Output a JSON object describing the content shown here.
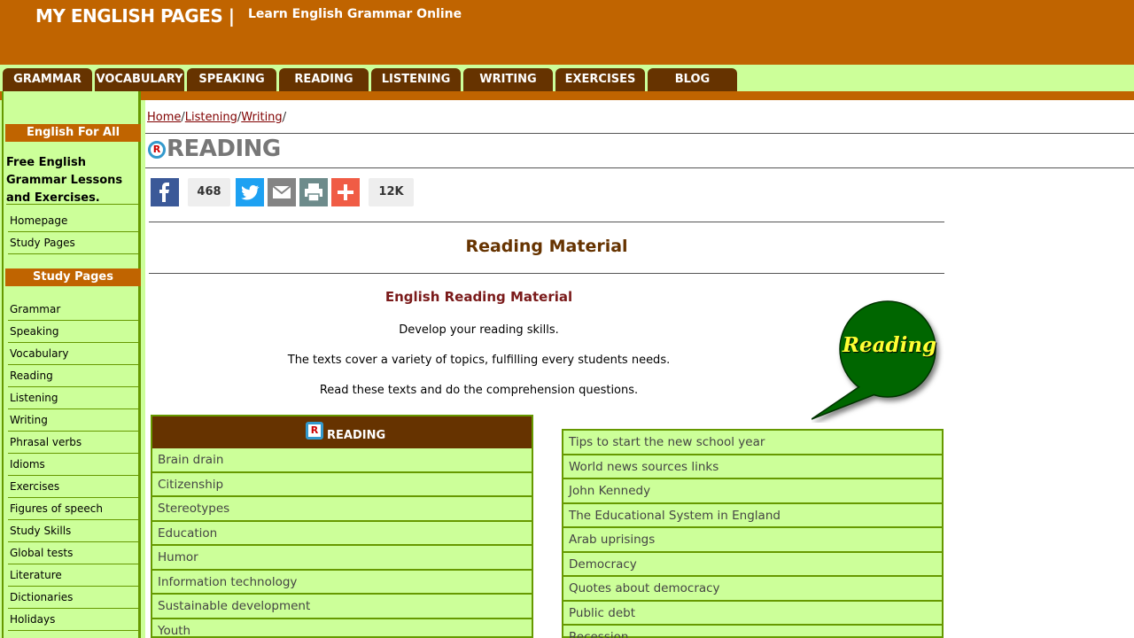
{
  "header": {
    "site_title": "MY ENGLISH PAGES |",
    "tagline": "Learn English Grammar Online"
  },
  "nav": {
    "tabs": [
      "GRAMMAR",
      "VOCABULARY",
      "SPEAKING",
      "READING",
      "LISTENING",
      "WRITING",
      "EXERCISES",
      "BLOG"
    ]
  },
  "sidebar": {
    "head1": "English For All",
    "promo": "Free English Grammar Lessons and Exercises.",
    "links1": [
      "Homepage",
      "Study Pages"
    ],
    "head2": "Study Pages",
    "links2": [
      "Grammar",
      "Speaking",
      "Vocabulary",
      "Reading",
      "Listening",
      "Writing",
      "Phrasal verbs",
      "Idioms",
      "Exercises",
      "Figures of speech",
      "Study Skills",
      "Global tests",
      "Literature",
      "Dictionaries",
      "Holidays"
    ]
  },
  "breadcrumb": {
    "home": "Home",
    "listening": "Listening",
    "writing": "Writing",
    "sep": "/"
  },
  "page_title": "READING",
  "logo_letter": "R",
  "share": {
    "facebook_count": "468",
    "total_count": "12K"
  },
  "section_title": "Reading Material",
  "subheading": "English Reading Material",
  "descriptions": [
    "Develop your reading skills.",
    "The texts cover a variety of topics, fulfilling every students needs.",
    "Read these texts and do the comprehension questions."
  ],
  "bubble_text": "Reading",
  "left_list": {
    "title": "READING",
    "items": [
      "Brain drain",
      "Citizenship",
      "Stereotypes",
      "Education",
      "Humor",
      "Information technology",
      "Sustainable development",
      "Youth"
    ]
  },
  "right_list": {
    "items": [
      "Tips to start the new school year",
      "World news sources links",
      "John Kennedy",
      "The Educational System in England",
      "Arab uprisings",
      "Democracy",
      "Quotes about democracy",
      "Public debt",
      "Recession"
    ]
  },
  "colors": {
    "header": "#c06400",
    "nav_tab": "#663300",
    "sidebar_bg": "#ccff99",
    "border": "#669900",
    "bubble": "#006600"
  }
}
